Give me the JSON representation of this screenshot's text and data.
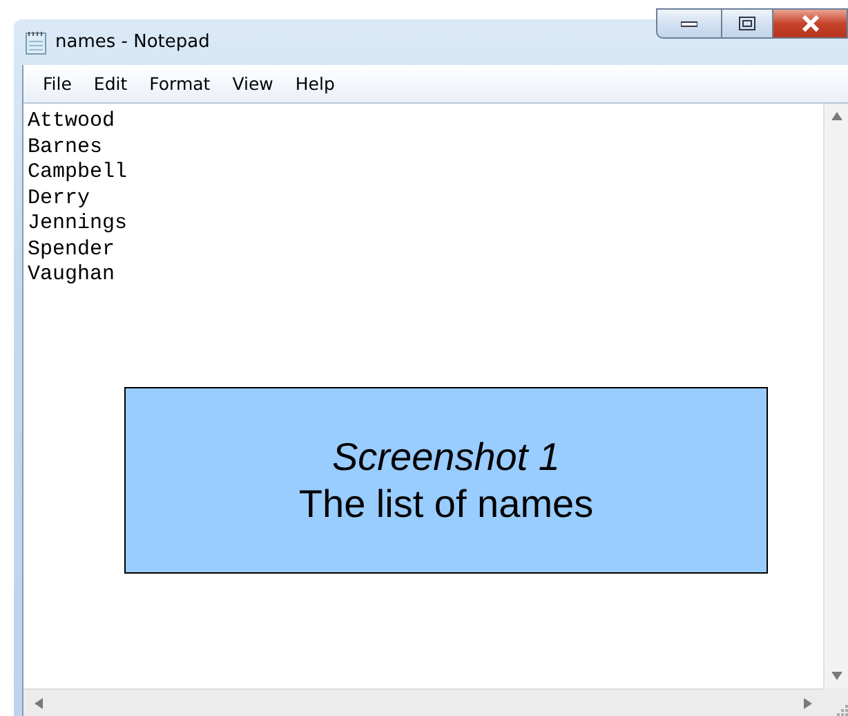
{
  "window": {
    "title": "names - Notepad"
  },
  "menu": [
    "File",
    "Edit",
    "Format",
    "View",
    "Help"
  ],
  "editor": {
    "lines": [
      "Attwood",
      "Barnes",
      "Campbell",
      "Derry",
      "Jennings",
      "Spender",
      "Vaughan"
    ]
  },
  "callout": {
    "lines": [
      {
        "text": "Screenshot 1",
        "italic": true
      },
      {
        "text": "The list of names",
        "italic": false
      }
    ]
  }
}
